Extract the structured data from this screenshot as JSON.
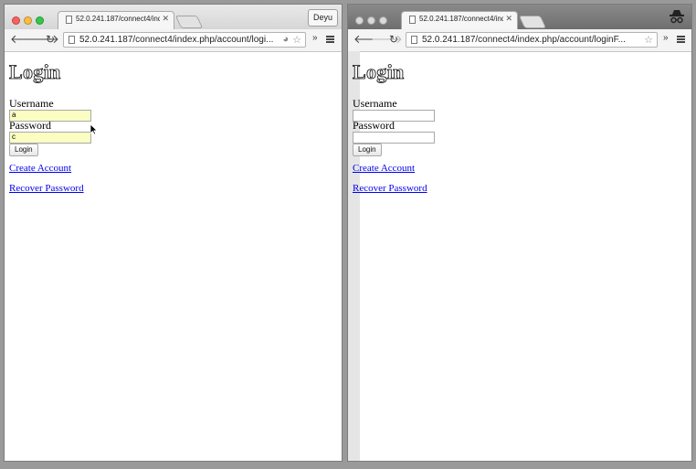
{
  "left_window": {
    "tab_title": "52.0.241.187/connect4/ind",
    "url": "52.0.241.187/connect4/index.php/account/logi...",
    "profile_label": "Deyu",
    "page": {
      "heading": "Login",
      "username_label": "Username",
      "username_value": "a",
      "password_label": "Password",
      "password_value": "c",
      "login_button": "Login",
      "create_account_link": "Create Account",
      "recover_password_link": "Recover Password"
    }
  },
  "right_window": {
    "tab_title": "52.0.241.187/connect4/ind",
    "url": "52.0.241.187/connect4/index.php/account/loginF...",
    "page": {
      "heading": "Login",
      "username_label": "Username",
      "password_label": "Password",
      "login_button": "Login",
      "create_account_link": "Create Account",
      "recover_password_link": "Recover Password"
    }
  },
  "colors": {
    "traffic_red": "#fc605c",
    "traffic_yellow": "#fdbc40",
    "traffic_green": "#34c84a",
    "autofill_yellow": "#fbfec2",
    "link_blue": "#0000ee"
  },
  "icons": [
    "page-icon",
    "close-icon",
    "back-icon",
    "forward-icon",
    "reload-icon",
    "reddit-extension-icon",
    "star-icon",
    "chevron-double-right-icon",
    "hamburger-menu-icon",
    "incognito-icon",
    "mouse-pointer-icon"
  ]
}
